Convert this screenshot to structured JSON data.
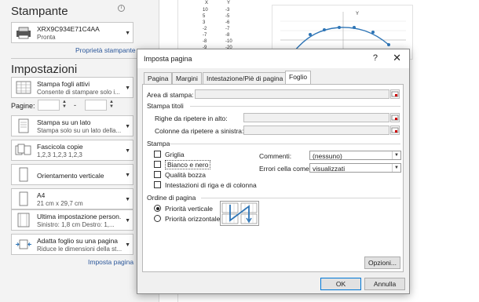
{
  "printer": {
    "section_title": "Stampante",
    "name": "XRX9C934E71C4AA",
    "status": "Pronta",
    "properties_link": "Proprietà stampante",
    "info_icon": "info-icon"
  },
  "settings": {
    "section_title": "Impostazioni",
    "pages_label": "Pagine:",
    "options": [
      {
        "line1": "Stampa fogli attivi",
        "line2": "Consente di stampare solo i...",
        "icon": "sheets-icon"
      },
      {
        "line1": "Stampa su un lato",
        "line2": "Stampa solo su un lato della...",
        "icon": "one-side-icon"
      },
      {
        "line1": "Fascicola copie",
        "line2": "1,2,3    1,2,3    1,2,3",
        "icon": "collate-icon"
      },
      {
        "line1": "Orientamento verticale",
        "line2": "",
        "icon": "portrait-icon"
      },
      {
        "line1": "A4",
        "line2": "21 cm x 29,7 cm",
        "icon": "paper-size-icon"
      },
      {
        "line1": "Ultima impostazione person...",
        "line2": "Sinistro: 1,8 cm    Destro: 1,...",
        "icon": "margins-icon"
      },
      {
        "line1": "Adatta foglio su una pagina",
        "line2": "Riduce le dimensioni della st...",
        "icon": "fit-page-icon"
      }
    ],
    "page_setup_link": "Imposta pagina"
  },
  "sheet": {
    "headers": [
      "X",
      "Y"
    ],
    "rows": [
      [
        "10",
        "-3"
      ],
      [
        "5",
        "-5"
      ],
      [
        "3",
        "-6"
      ],
      [
        "-2",
        "-7"
      ],
      [
        "-7",
        "-8"
      ],
      [
        "-8",
        "-10"
      ],
      [
        "-9",
        "-20"
      ]
    ],
    "chart_axis_label": "Y"
  },
  "dialog": {
    "title": "Imposta pagina",
    "help_label": "?",
    "close_label": "✕",
    "tabs": [
      "Pagina",
      "Margini",
      "Intestazione/Piè di pagina",
      "Foglio"
    ],
    "active_tab": "Foglio",
    "print_area_label": "Area di stampa:",
    "print_titles_group": "Stampa titoli",
    "rows_repeat_label": "Righe da ripetere in alto:",
    "cols_repeat_label": "Colonne da ripetere a sinistra:",
    "print_group": "Stampa",
    "gridlines_label": "Griglia",
    "bw_label": "Bianco e nero",
    "draft_label": "Qualità bozza",
    "headings_label": "Intestazioni di riga e di colonna",
    "comments_label": "Commenti:",
    "comments_value": "(nessuno)",
    "errors_label": "Errori cella come:",
    "errors_value": "visualizzati",
    "page_order_group": "Ordine di pagina",
    "down_then_over": "Priorità verticale",
    "over_then_down": "Priorità orizzontale",
    "options_btn": "Opzioni...",
    "ok_btn": "OK",
    "cancel_btn": "Annulla",
    "gridlines_checked": false,
    "bw_checked": false,
    "draft_checked": false,
    "headings_checked": false,
    "selected_order": "Priorità verticale"
  },
  "colors": {
    "link": "#2b579a",
    "accent": "#0078d7",
    "chart_line": "#2e75b6"
  }
}
